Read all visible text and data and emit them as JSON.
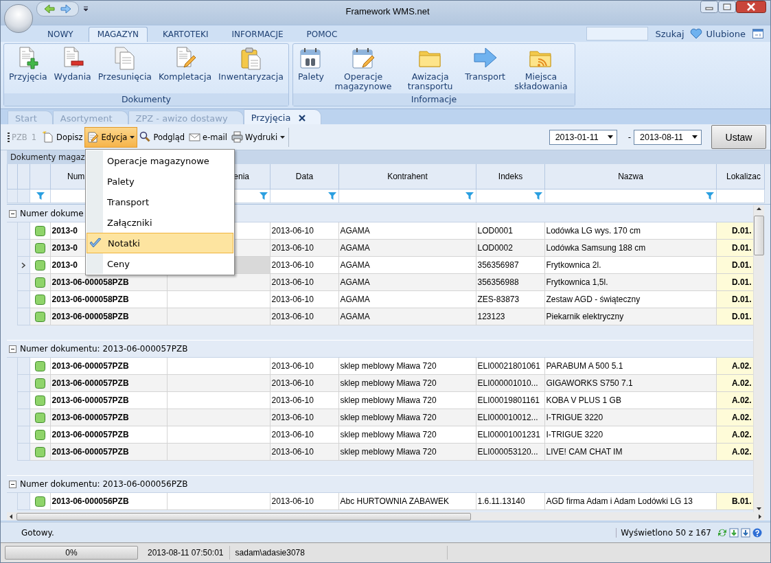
{
  "window": {
    "title": "Framework WMS.net"
  },
  "ribbon": {
    "tabs": [
      {
        "label": "NOWY",
        "selected": false
      },
      {
        "label": "MAGAZYN",
        "selected": true
      },
      {
        "label": "KARTOTEKI",
        "selected": false
      },
      {
        "label": "INFORMACJE",
        "selected": false
      },
      {
        "label": "POMOC",
        "selected": false
      }
    ],
    "search_link": "Szukaj",
    "favorites": "Ulubione",
    "groups": [
      {
        "title": "Dokumenty",
        "buttons": [
          "Przyjęcia",
          "Wydania",
          "Przesunięcia",
          "Kompletacja",
          "Inwentaryzacja"
        ]
      },
      {
        "title": "Informacje",
        "buttons": [
          "Palety",
          "Operacje magazynowe",
          "Awizacja transportu",
          "Transport",
          "Miejsca składowania"
        ]
      }
    ]
  },
  "document_tabs": [
    {
      "label": "Start",
      "selected": false
    },
    {
      "label": "Asortyment",
      "selected": false
    },
    {
      "label": "ZPZ - awizo dostawy",
      "selected": false
    },
    {
      "label": "Przyjęcia",
      "selected": true
    }
  ],
  "toolbar": {
    "items": [
      {
        "kind": "label",
        "label": "PZB",
        "disabled": true
      },
      {
        "kind": "label",
        "label": "1",
        "disabled": true
      },
      {
        "kind": "button",
        "label": "Dopisz",
        "dropdown": false,
        "open": false
      },
      {
        "kind": "button",
        "label": "Edycja",
        "dropdown": true,
        "open": true
      },
      {
        "kind": "button",
        "label": "Podgląd",
        "dropdown": false,
        "open": false
      },
      {
        "kind": "button",
        "label": "e-mail",
        "dropdown": false,
        "open": false
      },
      {
        "kind": "button",
        "label": "Wydruki",
        "dropdown": true,
        "open": false
      }
    ],
    "date_from": "2013-01-11",
    "separator": "-",
    "date_to": "2013-08-11",
    "apply_button": "Ustaw"
  },
  "edit_menu": [
    {
      "label": "Operacje magazynowe",
      "selected": false
    },
    {
      "label": "Palety",
      "selected": false
    },
    {
      "label": "Transport",
      "selected": false
    },
    {
      "label": "Załączniki",
      "selected": false
    },
    {
      "label": "Notatki",
      "selected": true
    },
    {
      "label": "Ceny",
      "selected": false
    }
  ],
  "grid": {
    "caption": "Dokumenty magaz",
    "columns": [
      "Num",
      "enia",
      "Data",
      "Kontrahent",
      "Indeks",
      "Nazwa",
      "Lokalizac"
    ],
    "groups": [
      {
        "title": "Numer dokume",
        "expanded": true,
        "rows": [
          {
            "numer": "2013-0",
            "data": "2013-06-10",
            "kontrahent": "AGAMA",
            "indeks": "LOD0001",
            "nazwa": "Lodówka LG wys. 170 cm",
            "lokalizacja": "D.01.",
            "current": false
          },
          {
            "numer": "2013-0",
            "data": "2013-06-10",
            "kontrahent": "AGAMA",
            "indeks": "LOD0002",
            "nazwa": "Lodówka Samsung 188 cm",
            "lokalizacja": "D.01.",
            "current": false
          },
          {
            "numer": "2013-0",
            "data": "2013-06-10",
            "kontrahent": "AGAMA",
            "indeks": "356356987",
            "nazwa": "Frytkownica 2l.",
            "lokalizacja": "D.01.",
            "current": true
          },
          {
            "numer": "2013-06-000058PZB",
            "data": "2013-06-10",
            "kontrahent": "AGAMA",
            "indeks": "356356988",
            "nazwa": "Frytkownica 1,5l.",
            "lokalizacja": "D.01.",
            "current": false
          },
          {
            "numer": "2013-06-000058PZB",
            "data": "2013-06-10",
            "kontrahent": "AGAMA",
            "indeks": "ZES-83873",
            "nazwa": "Zestaw AGD - świąteczny",
            "lokalizacja": "D.01.",
            "current": false
          },
          {
            "numer": "2013-06-000058PZB",
            "data": "2013-06-10",
            "kontrahent": "AGAMA",
            "indeks": "123123",
            "nazwa": "Piekarnik elektryczny",
            "lokalizacja": "D.01.",
            "current": false
          }
        ]
      },
      {
        "title": "Numer dokumentu: 2013-06-000057PZB",
        "expanded": true,
        "rows": [
          {
            "numer": "2013-06-000057PZB",
            "data": "2013-06-10",
            "kontrahent": "sklep meblowy Mława 720",
            "indeks": "ELI00021801061",
            "nazwa": "PARABUM A 500 5.1",
            "lokalizacja": "A.02.",
            "current": false
          },
          {
            "numer": "2013-06-000057PZB",
            "data": "2013-06-10",
            "kontrahent": "sklep meblowy Mława 720",
            "indeks": "ELI000001010...",
            "nazwa": "GIGAWORKS S750 7.1",
            "lokalizacja": "A.02.",
            "current": false
          },
          {
            "numer": "2013-06-000057PZB",
            "data": "2013-06-10",
            "kontrahent": "sklep meblowy Mława 720",
            "indeks": "ELI00019801161",
            "nazwa": "KOBA V PLUS 1 GB",
            "lokalizacja": "A.02.",
            "current": false
          },
          {
            "numer": "2013-06-000057PZB",
            "data": "2013-06-10",
            "kontrahent": "sklep meblowy Mława 720",
            "indeks": "ELI000010012...",
            "nazwa": "I-TRIGUE 3220",
            "lokalizacja": "A.02.",
            "current": false
          },
          {
            "numer": "2013-06-000057PZB",
            "data": "2013-06-10",
            "kontrahent": "sklep meblowy Mława 720",
            "indeks": "ELI00001001231",
            "nazwa": "I-TRIGUE 3220",
            "lokalizacja": "A.02.",
            "current": false
          },
          {
            "numer": "2013-06-000057PZB",
            "data": "2013-06-10",
            "kontrahent": "sklep meblowy Mława 720",
            "indeks": "ELI000053120...",
            "nazwa": "LIVE! CAM CHAT IM",
            "lokalizacja": "A.02.",
            "current": false
          }
        ]
      },
      {
        "title": "Numer dokumentu: 2013-06-000056PZB",
        "expanded": true,
        "rows": [
          {
            "numer": "2013-06-000056PZB",
            "data": "2013-06-10",
            "kontrahent": "Abc HURTOWNIA ZABAWEK",
            "indeks": "1.6.11.13140",
            "nazwa": "AGD firma Adam i Adam Lodówki LG 13",
            "lokalizacja": "B.01.",
            "current": false
          }
        ]
      }
    ]
  },
  "status_bar": {
    "message": "Gotowy.",
    "count": "Wyświetlono 50 z 167"
  },
  "bottom_bar": {
    "progress": {
      "level": 0,
      "label": "0%"
    },
    "timestamp": "2013-08-11 07:50:01",
    "user": "sadam\\adasie3078"
  }
}
